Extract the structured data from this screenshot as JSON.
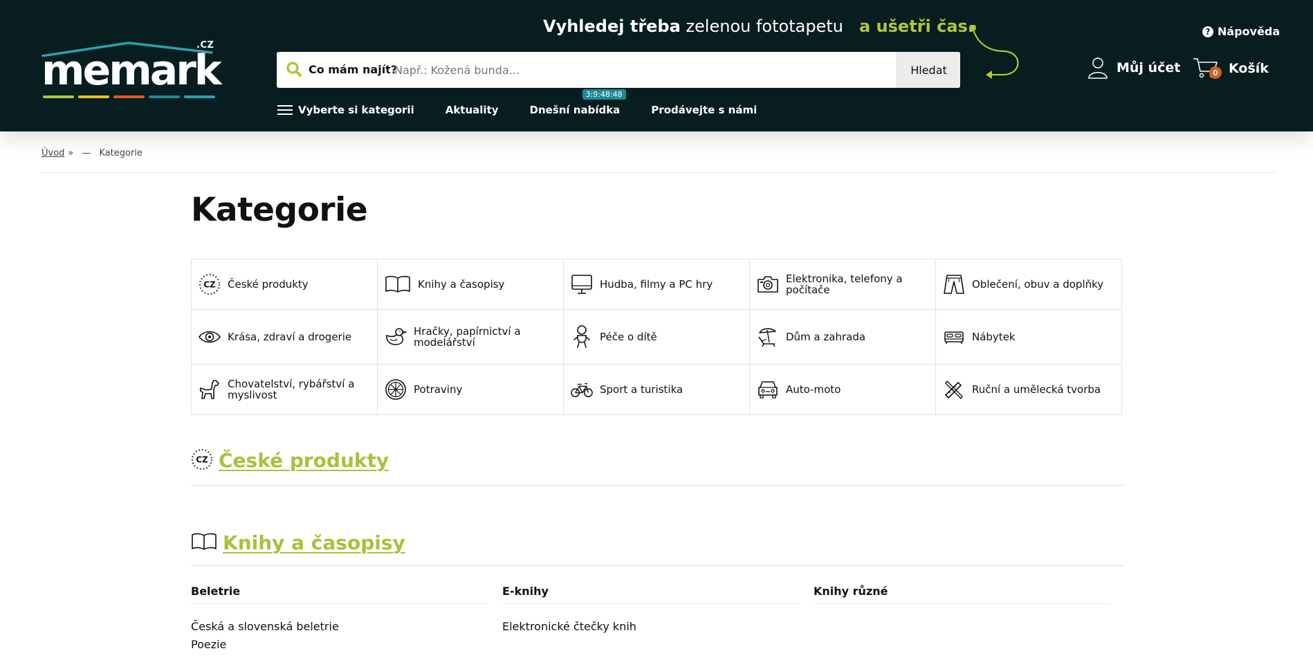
{
  "brand": {
    "logo_text": "memark",
    "logo_suffix": ".CZ",
    "stripe_colors": [
      "#b1c83c",
      "#e8c41b",
      "#e4571d",
      "#1b8a97",
      "#28a3b0"
    ]
  },
  "header": {
    "tagline_bold": "Vyhledej třeba",
    "tagline_rest": " zelenou fototapetu",
    "tagline_save": "a ušetři čas.",
    "search_label": "Co mám najít?",
    "search_placeholder": "Např.: Kožená bunda...",
    "search_value": "",
    "search_button": "Hledat",
    "help_label": "Nápověda",
    "account_label": "Můj účet",
    "cart_label": "Košík",
    "cart_count": "0"
  },
  "nav": {
    "categories": "Vyberte si kategorii",
    "news": "Aktuality",
    "today_offer": "Dnešní nabídka",
    "timer": "3:9:48:48",
    "sell": "Prodávejte s námi"
  },
  "breadcrumb": {
    "home": "Úvod",
    "separator": "»",
    "dash": "—",
    "current": "Kategorie"
  },
  "page": {
    "title": "Kategorie"
  },
  "categories": [
    {
      "label": "České produkty",
      "icon": "cz-icon"
    },
    {
      "label": "Knihy a časopisy",
      "icon": "book-icon"
    },
    {
      "label": "Hudba, filmy a PC hry",
      "icon": "monitor-icon"
    },
    {
      "label": "Elektronika, telefony a počítače",
      "icon": "camera-icon"
    },
    {
      "label": "Oblečení, obuv a doplňky",
      "icon": "pants-icon"
    },
    {
      "label": "Krása, zdraví a drogerie",
      "icon": "eye-icon"
    },
    {
      "label": "Hračky, papírnictví a modelářství",
      "icon": "duck-icon"
    },
    {
      "label": "Péče o dítě",
      "icon": "baby-icon"
    },
    {
      "label": "Dům a zahrada",
      "icon": "deckchair-icon"
    },
    {
      "label": "Nábytek",
      "icon": "bed-icon"
    },
    {
      "label": "Chovatelství, rybářství a myslivost",
      "icon": "dog-icon"
    },
    {
      "label": "Potraviny",
      "icon": "citrus-icon"
    },
    {
      "label": "Sport a turistika",
      "icon": "bicycle-icon"
    },
    {
      "label": "Auto-moto",
      "icon": "car-icon"
    },
    {
      "label": "Ruční a umělecká tvorba",
      "icon": "craft-tools-icon"
    }
  ],
  "sections": {
    "czech": {
      "title": "České produkty",
      "icon": "cz-icon"
    },
    "books": {
      "title": "Knihy a časopisy",
      "icon": "book-icon",
      "columns": [
        {
          "heading": "Beletrie",
          "links": [
            "Česká a slovenská beletrie",
            "Poezie"
          ]
        },
        {
          "heading": "E-knihy",
          "links": [
            "Elektronické čtečky knih"
          ]
        },
        {
          "heading": "Knihy různé",
          "links": []
        }
      ]
    }
  }
}
